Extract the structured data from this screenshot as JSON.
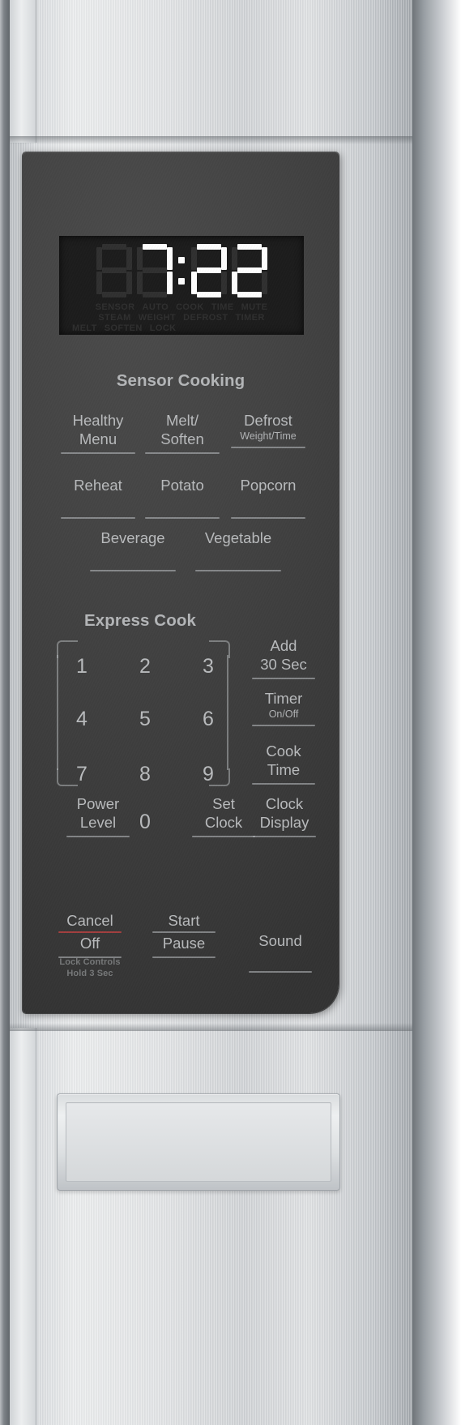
{
  "appliance": {
    "type": "microwave-oven-control-panel",
    "finish": "stainless-steel",
    "panel_color": "#3e3e3e",
    "text_color": "#b9bbbd",
    "accent_red": "#a33f3f"
  },
  "display": {
    "time": "7:22",
    "digits": [
      "8",
      "7",
      "2",
      "2"
    ],
    "digit_states": [
      "off",
      "on",
      "on",
      "on"
    ],
    "colon": ":",
    "indicator_rows": [
      [
        "SENSOR",
        "AUTO",
        "COOK",
        "TIME",
        "MUTE"
      ],
      [
        "STEAM",
        "WEIGHT",
        "DEFROST",
        "TIMER"
      ],
      [
        "MELT",
        "SOFTEN",
        "LOCK"
      ]
    ]
  },
  "sensor_cooking": {
    "heading": "Sensor Cooking",
    "row1": [
      {
        "line1": "Healthy",
        "line2": "Menu",
        "sub": ""
      },
      {
        "line1": "Melt/",
        "line2": "Soften",
        "sub": ""
      },
      {
        "line1": "Defrost",
        "line2": "",
        "sub": "Weight/Time"
      }
    ],
    "row2": [
      {
        "line1": "Reheat"
      },
      {
        "line1": "Potato"
      },
      {
        "line1": "Popcorn"
      }
    ],
    "row3": [
      {
        "line1": "Beverage"
      },
      {
        "line1": "Vegetable"
      }
    ]
  },
  "express_cook": {
    "heading": "Express Cook",
    "keypad": [
      "1",
      "2",
      "3",
      "4",
      "5",
      "6",
      "7",
      "8",
      "9",
      "0"
    ],
    "side_keys": [
      {
        "line1": "Add",
        "line2": "30 Sec",
        "sub": ""
      },
      {
        "line1": "Timer",
        "line2": "",
        "sub": "On/Off"
      },
      {
        "line1": "Cook",
        "line2": "Time",
        "sub": ""
      },
      {
        "line1": "Clock",
        "line2": "Display",
        "sub": ""
      }
    ],
    "bottom_row": [
      {
        "line1": "Power",
        "line2": "Level"
      },
      {
        "line1": "Set",
        "line2": "Clock"
      }
    ]
  },
  "action_row": {
    "cancel": {
      "line1": "Cancel",
      "line2": "Off"
    },
    "start": {
      "line1": "Start",
      "line2": "Pause"
    },
    "sound": {
      "line1": "Sound"
    },
    "lock_note_line1": "Lock Controls",
    "lock_note_line2": "Hold 3 Sec"
  }
}
